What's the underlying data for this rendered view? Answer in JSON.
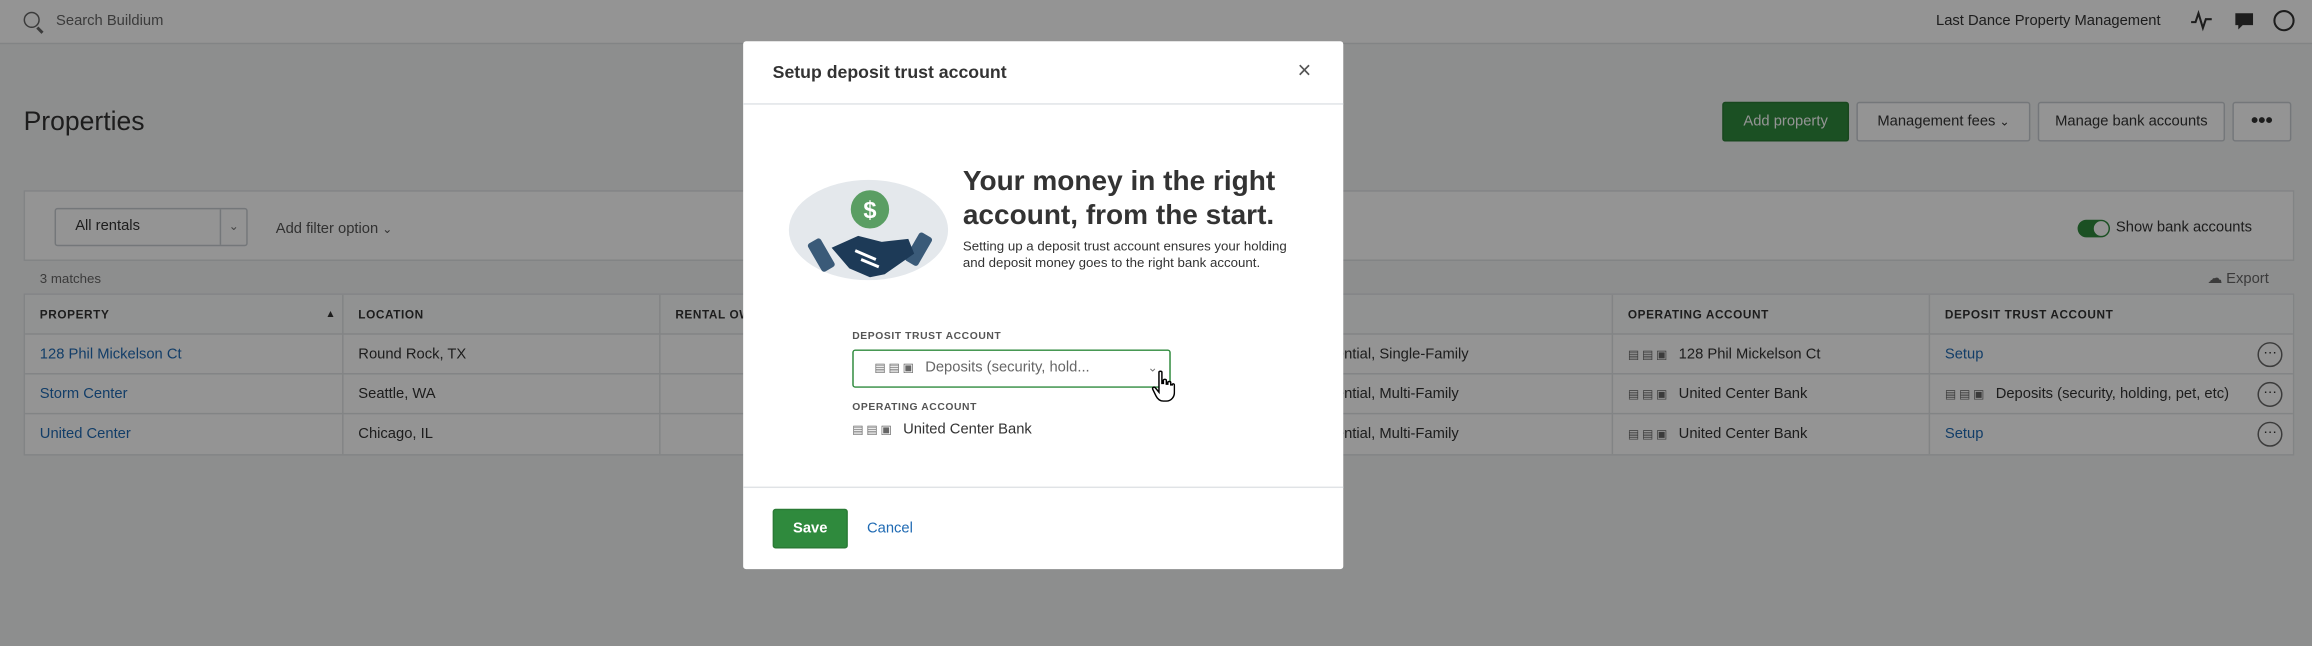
{
  "topbar": {
    "search_placeholder": "Search Buildium",
    "company": "Last Dance Property Management"
  },
  "page": {
    "title": "Properties",
    "buttons": {
      "add_property": "Add property",
      "management_fees": "Management fees",
      "manage_bank_accounts": "Manage bank accounts"
    }
  },
  "filters": {
    "rental_filter": "All rentals",
    "add_filter": "Add filter option",
    "show_bank_accounts": "Show bank accounts"
  },
  "table": {
    "matches": "3 matches",
    "export": "Export",
    "headers": {
      "property": "PROPERTY",
      "location": "LOCATION",
      "rental_owners": "RENTAL OW",
      "operating_account": "OPERATING ACCOUNT",
      "deposit_trust_account": "DEPOSIT TRUST ACCOUNT"
    },
    "rows": [
      {
        "property": "128 Phil Mickelson Ct",
        "location": "Round Rock, TX",
        "type": "ential, Single-Family",
        "operating": "128 Phil Mickelson Ct",
        "deposit": "Setup"
      },
      {
        "property": "Storm Center",
        "location": "Seattle, WA",
        "type": "ential, Multi-Family",
        "operating": "United Center Bank",
        "deposit": "Deposits (security, holding, pet, etc)"
      },
      {
        "property": "United Center",
        "location": "Chicago, IL",
        "type": "ential, Multi-Family",
        "operating": "United Center Bank",
        "deposit": "Setup"
      }
    ]
  },
  "modal": {
    "title": "Setup deposit trust account",
    "close": "×",
    "headline": "Your money in the right account, from the start.",
    "description": "Setting up a deposit trust account ensures your holding and deposit money goes to the right bank account.",
    "deposit_label": "DEPOSIT TRUST ACCOUNT",
    "deposit_value": "Deposits (security, hold...",
    "operating_label": "OPERATING ACCOUNT",
    "operating_value": "United Center Bank",
    "save": "Save",
    "cancel": "Cancel",
    "illustration_symbol": "$"
  },
  "colors": {
    "primary_green": "#2f8a3d",
    "link_blue": "#1f6ab3",
    "illustration_navy": "#1d3a57"
  }
}
